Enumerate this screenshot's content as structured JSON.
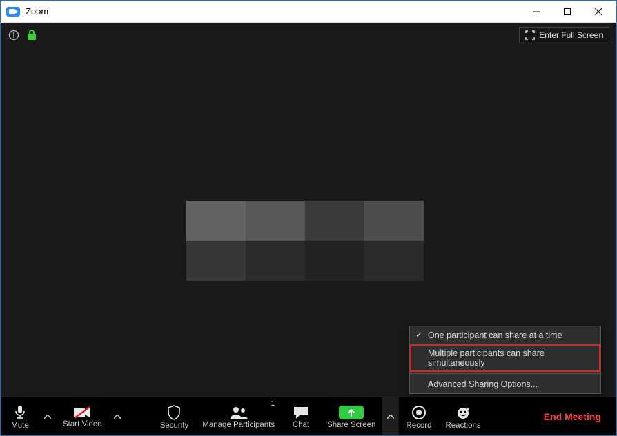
{
  "app": {
    "title": "Zoom"
  },
  "topbar": {
    "fullscreen_label": "Enter Full Screen"
  },
  "share_menu": {
    "opt_single": "One participant can share at a time",
    "opt_multiple": "Multiple participants can share simultaneously",
    "advanced": "Advanced Sharing Options..."
  },
  "toolbar": {
    "mute": "Mute",
    "start_video": "Start Video",
    "security": "Security",
    "manage_participants": "Manage Participants",
    "participants_count": "1",
    "chat": "Chat",
    "share_screen": "Share Screen",
    "record": "Record",
    "reactions": "Reactions",
    "end_meeting": "End Meeting"
  }
}
